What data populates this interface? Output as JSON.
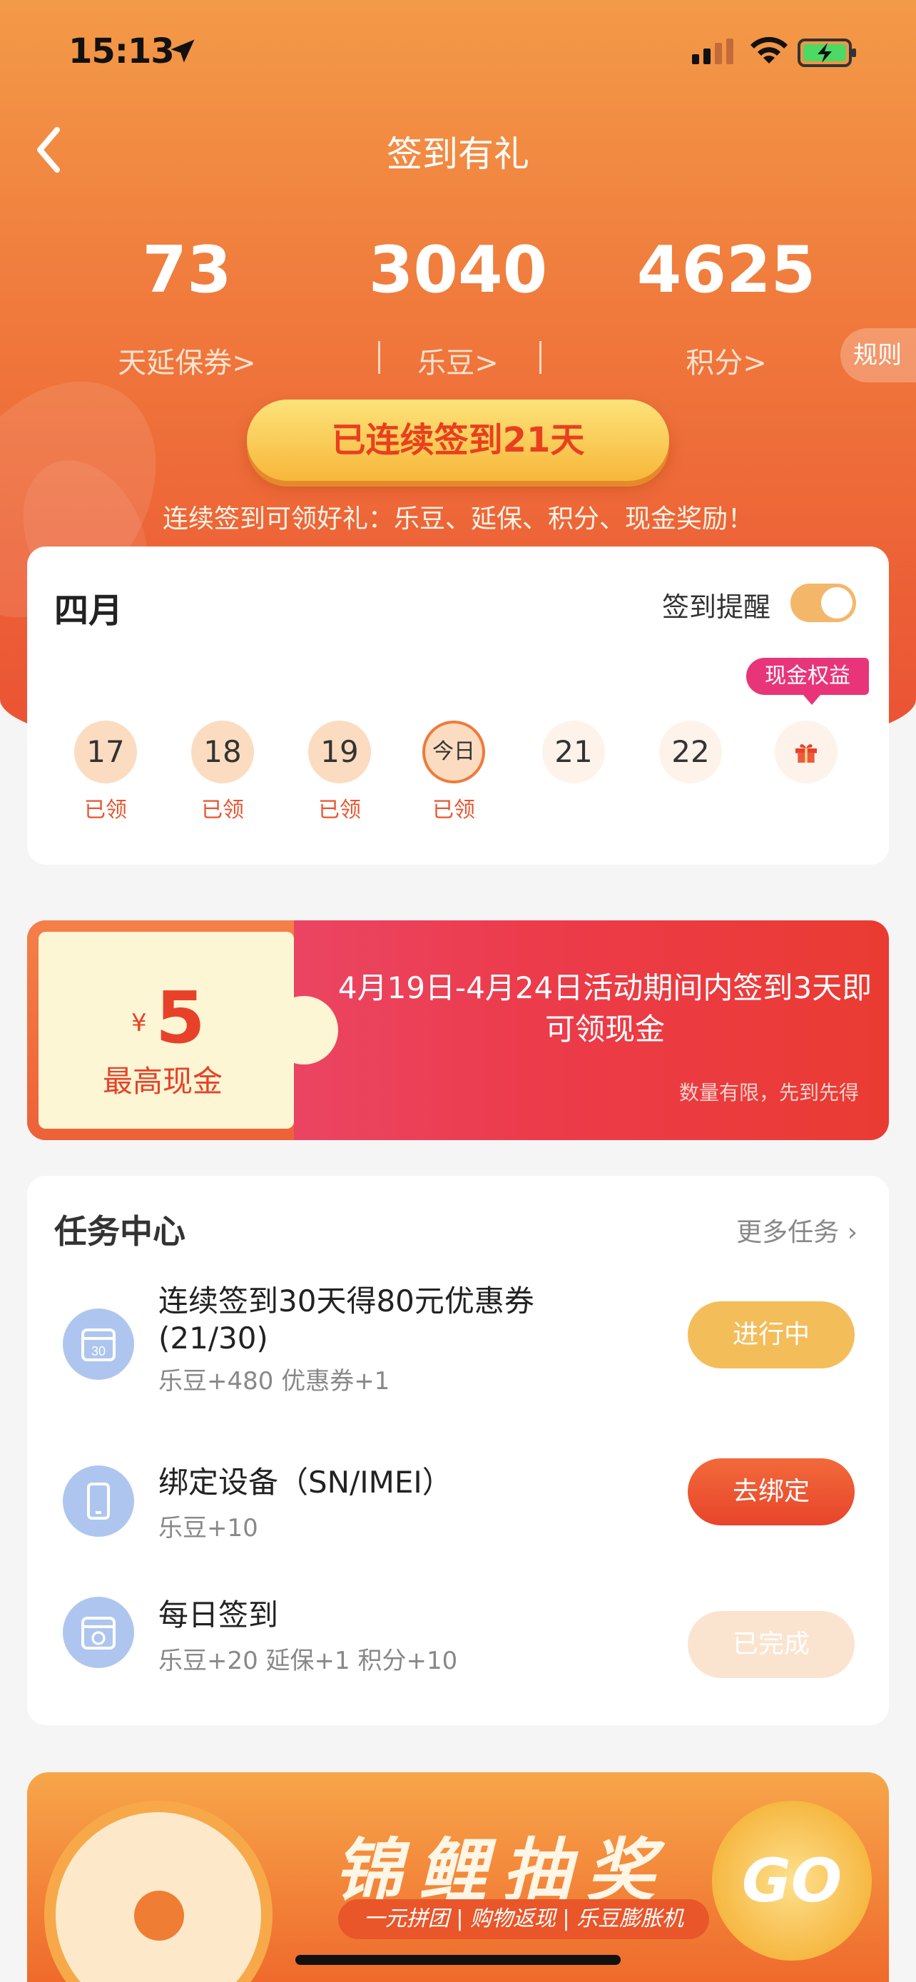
{
  "status": {
    "time": "15:13"
  },
  "nav": {
    "title": "签到有礼"
  },
  "stats": [
    {
      "value": "73",
      "label": "天延保券>"
    },
    {
      "value": "3040",
      "label": "乐豆>"
    },
    {
      "value": "4625",
      "label": "积分>"
    }
  ],
  "rules_label": "规则",
  "streak_label": "已连续签到21天",
  "hint": "连续签到可领好礼：乐豆、延保、积分、现金奖励！",
  "calendar": {
    "month": "四月",
    "reminder_label": "签到提醒",
    "reminder_on": true,
    "cash_tag": "现金权益",
    "days": [
      {
        "label": "17",
        "status": "已领"
      },
      {
        "label": "18",
        "status": "已领"
      },
      {
        "label": "19",
        "status": "已领"
      },
      {
        "label": "今日",
        "status": "已领"
      },
      {
        "label": "21",
        "status": ""
      },
      {
        "label": "22",
        "status": ""
      },
      {
        "label": "gift-icon",
        "status": ""
      }
    ]
  },
  "cash_banner": {
    "currency": "¥",
    "amount": "5",
    "amount_label": "最高现金",
    "description": "4月19日-4月24日活动期间内签到3天即可领现金",
    "note": "数量有限，先到先得"
  },
  "tasks": {
    "title": "任务中心",
    "more_label": "更多任务 ›",
    "items": [
      {
        "name": "连续签到30天得80元优惠券 (21/30)",
        "reward": "乐豆+480 优惠券+1",
        "button": "进行中",
        "icon": "calendar-30-icon"
      },
      {
        "name": "绑定设备（SN/IMEI）",
        "reward": "乐豆+10",
        "button": "去绑定",
        "icon": "phone-icon"
      },
      {
        "name": "每日签到",
        "reward": "乐豆+20 延保+1 积分+10",
        "button": "已完成",
        "icon": "calendar-sign-icon"
      }
    ]
  },
  "lottery": {
    "title": "锦鲤抽奖",
    "subtitle": "一元拼团 | 购物返现 | 乐豆膨胀机",
    "go_label": "GO"
  },
  "colors": {
    "accent": "#f07a3c",
    "danger": "#e8412a",
    "pink": "#e8357a"
  }
}
